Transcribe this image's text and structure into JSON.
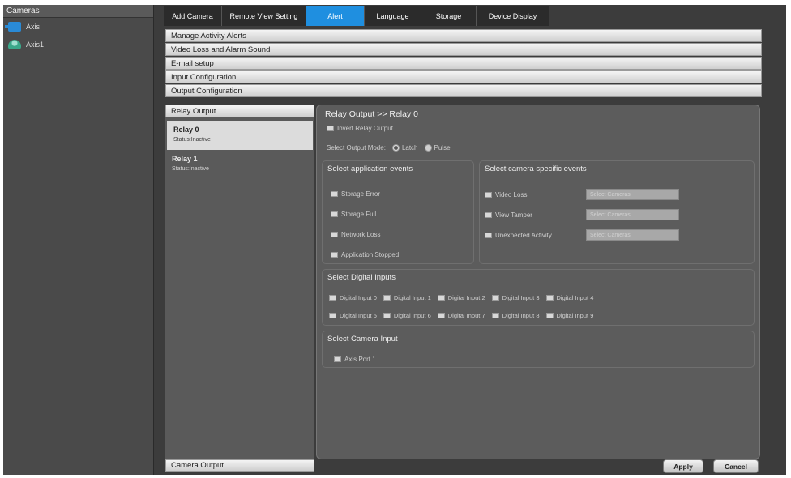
{
  "sidebar": {
    "title": "Cameras",
    "cameras": [
      {
        "label": "Axis",
        "icon": "camera-icon"
      },
      {
        "label": "Axis1",
        "icon": "dome-camera-icon"
      }
    ]
  },
  "tabs": [
    {
      "label": "Add Camera",
      "active": false
    },
    {
      "label": "Remote View Setting",
      "active": false
    },
    {
      "label": "Alert",
      "active": true
    },
    {
      "label": "Language",
      "active": false
    },
    {
      "label": "Storage",
      "active": false
    },
    {
      "label": "Device Display",
      "active": false
    }
  ],
  "accordion": [
    "Manage Activity Alerts",
    "Video Loss and Alarm Sound",
    "E-mail setup",
    "Input Configuration",
    "Output Configuration"
  ],
  "relay_output": {
    "header": "Relay Output",
    "items": [
      {
        "name": "Relay 0",
        "status": "Status:Inactive",
        "selected": true
      },
      {
        "name": "Relay 1",
        "status": "Status:Inactive",
        "selected": false
      }
    ]
  },
  "camera_output": "Camera Output",
  "panel": {
    "title": "Relay Output >> Relay 0",
    "invert_label": "Invert Relay Output",
    "output_mode": {
      "label": "Select Output Mode:",
      "options": [
        "Latch",
        "Pulse"
      ],
      "selected": "Latch"
    },
    "app_events": {
      "title": "Select application events",
      "items": [
        "Storage Error",
        "Storage Full",
        "Network Loss",
        "Application Stopped"
      ]
    },
    "camera_events": {
      "title": "Select camera specific events",
      "items": [
        "Video Loss",
        "View Tamper",
        "Unexpected Activity"
      ],
      "button_label": "Select Cameras"
    },
    "digital_inputs": {
      "title": "Select Digital Inputs",
      "row1": [
        "Digital Input 0",
        "Digital Input 1",
        "Digital Input 2",
        "Digital Input 3",
        "Digital Input 4"
      ],
      "row2": [
        "Digital Input 5",
        "Digital Input 6",
        "Digital Input 7",
        "Digital Input 8",
        "Digital Input 9"
      ]
    },
    "camera_input": {
      "title": "Select Camera Input",
      "items": [
        "Axis Port 1"
      ]
    }
  },
  "footer": {
    "apply": "Apply",
    "cancel": "Cancel"
  },
  "colors": {
    "accent": "#1f8fe0",
    "background": "#3c3c3c"
  }
}
